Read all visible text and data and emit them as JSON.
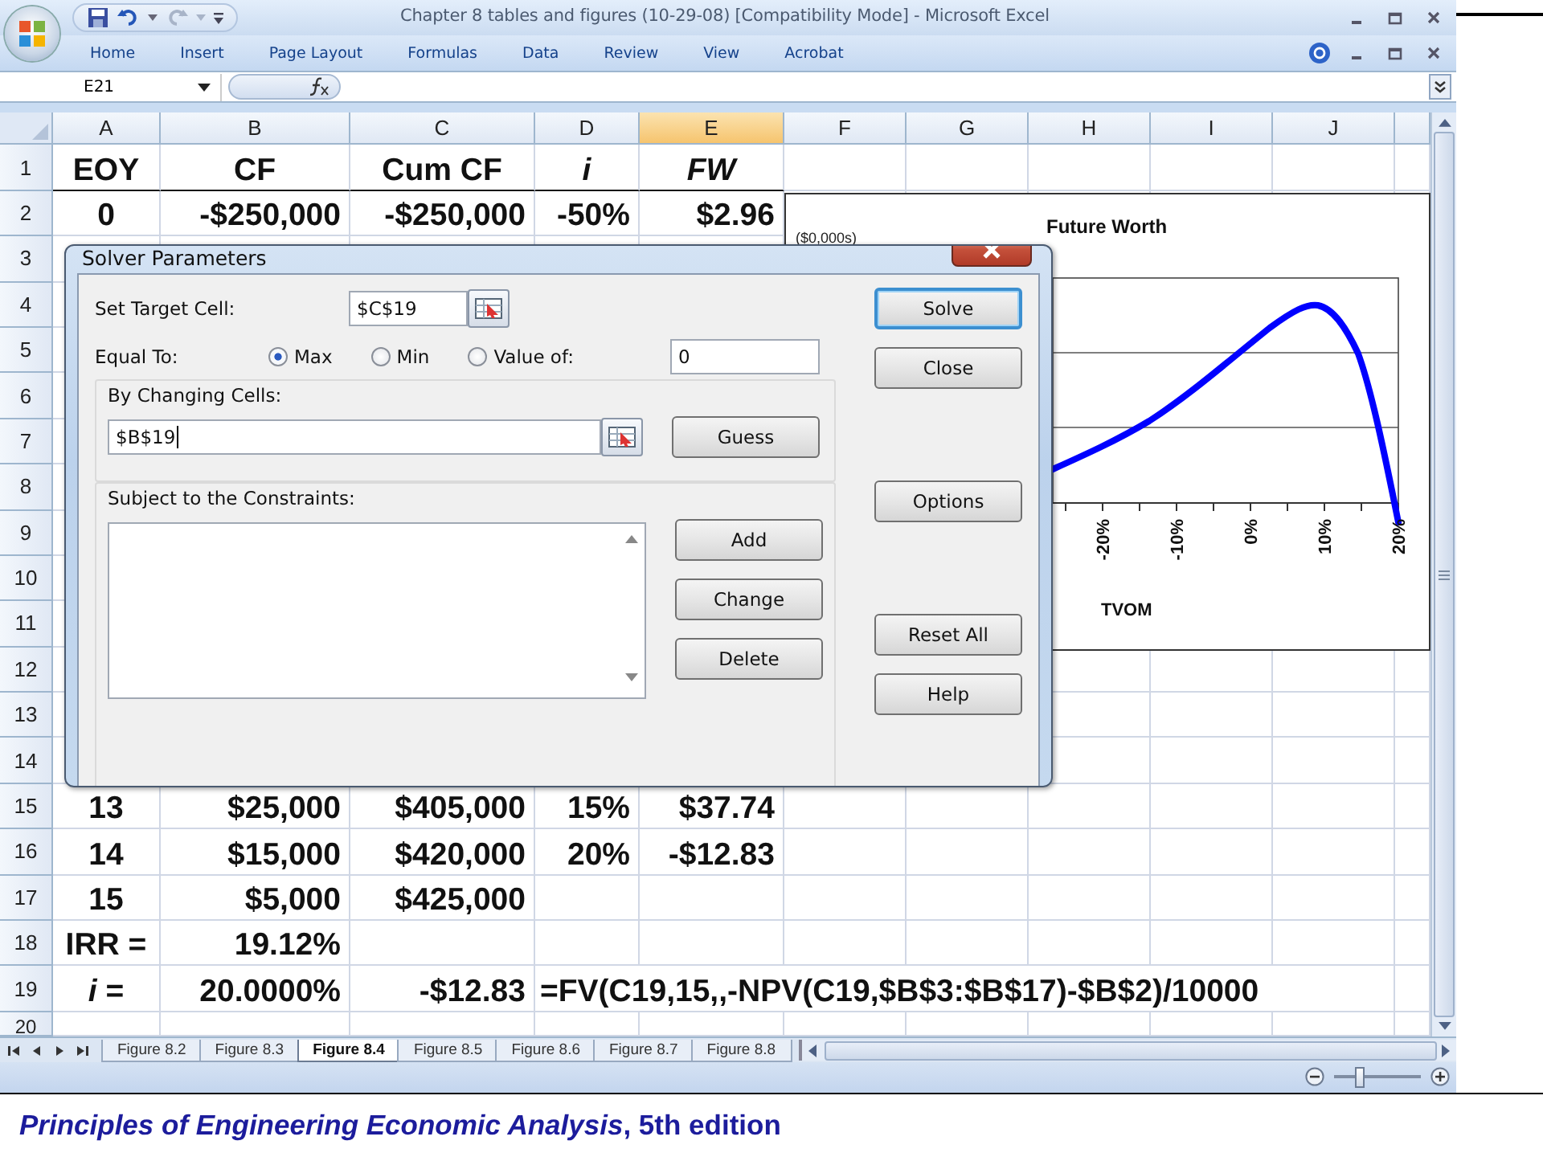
{
  "window": {
    "title": "Chapter 8 tables and figures (10-29-08)  [Compatibility Mode] - Microsoft Excel"
  },
  "ribbon_tabs": [
    {
      "label": "Home",
      "selected": false
    },
    {
      "label": "Insert",
      "selected": false
    },
    {
      "label": "Page Layout",
      "selected": false
    },
    {
      "label": "Formulas",
      "selected": false
    },
    {
      "label": "Data",
      "selected": false
    },
    {
      "label": "Review",
      "selected": false
    },
    {
      "label": "View",
      "selected": false
    },
    {
      "label": "Acrobat",
      "selected": false
    }
  ],
  "formula_bar": {
    "name_box": "E21"
  },
  "columns": [
    {
      "label": "A",
      "selected": false
    },
    {
      "label": "B",
      "selected": false
    },
    {
      "label": "C",
      "selected": false
    },
    {
      "label": "D",
      "selected": false
    },
    {
      "label": "E",
      "selected": true
    },
    {
      "label": "F",
      "selected": false
    },
    {
      "label": "G",
      "selected": false
    },
    {
      "label": "H",
      "selected": false
    },
    {
      "label": "I",
      "selected": false
    },
    {
      "label": "J",
      "selected": false
    }
  ],
  "header_row": {
    "num": "1",
    "cells": [
      {
        "text": "EOY",
        "italic": false
      },
      {
        "text": "CF",
        "italic": false
      },
      {
        "text": "Cum CF",
        "italic": false
      },
      {
        "text": "i",
        "italic": true
      },
      {
        "text": "FW",
        "italic": true
      }
    ]
  },
  "rows": [
    {
      "num": "2",
      "cells": [
        "0",
        "-$250,000",
        "-$250,000",
        "-50%",
        "$2.96"
      ]
    },
    {
      "num": "3"
    },
    {
      "num": "4"
    },
    {
      "num": "5"
    },
    {
      "num": "6"
    },
    {
      "num": "7"
    },
    {
      "num": "8"
    },
    {
      "num": "9"
    },
    {
      "num": "10"
    },
    {
      "num": "11"
    },
    {
      "num": "12"
    },
    {
      "num": "13"
    },
    {
      "num": "14"
    },
    {
      "num": "15",
      "cells": [
        "13",
        "$25,000",
        "$405,000",
        "15%",
        "$37.74"
      ]
    },
    {
      "num": "16",
      "cells": [
        "14",
        "$15,000",
        "$420,000",
        "20%",
        "-$12.83"
      ]
    },
    {
      "num": "17",
      "cells": [
        "15",
        "$5,000",
        "$425,000"
      ]
    },
    {
      "num": "18",
      "cells": [
        "IRR =",
        "19.12%"
      ]
    },
    {
      "num": "19",
      "cells": [
        "*i* =",
        "20.0000%",
        "-$12.83"
      ],
      "formula": "=FV(C19,15,,-NPV(C19,$B$3:$B$17)-$B$2)/10000"
    },
    {
      "num": "20"
    }
  ],
  "chart": {
    "title": "Future Worth",
    "unit_label": "($0,000s)",
    "x_tick_labels": [
      "-20%",
      "-10%",
      "0%",
      "10%",
      "20%"
    ],
    "xlabel": "TVOM"
  },
  "dialog": {
    "title": "Solver Parameters",
    "target": {
      "label": "Set Target Cell:",
      "value": "$C$19"
    },
    "equal_to": {
      "label": "Equal To:",
      "value": "0",
      "options": [
        {
          "label": "Max",
          "selected": true
        },
        {
          "label": "Min",
          "selected": false
        },
        {
          "label": "Value of:",
          "selected": false
        }
      ]
    },
    "changing": {
      "label": "By Changing Cells:",
      "value": "$B$19",
      "focused": true
    },
    "constraints": {
      "label": "Subject to the Constraints:"
    },
    "guess_button": {
      "label": "Guess"
    },
    "constraint_buttons": [
      {
        "label": "Add"
      },
      {
        "label": "Change"
      },
      {
        "label": "Delete"
      }
    ],
    "side_buttons": [
      {
        "label": "Solve",
        "default": true
      },
      {
        "label": "Close",
        "default": false
      },
      {
        "label": "Options",
        "default": false
      },
      {
        "label": "Reset All",
        "default": false
      },
      {
        "label": "Help",
        "default": false
      }
    ]
  },
  "sheet_tabs": [
    {
      "label": "Figure 8.2",
      "selected": false
    },
    {
      "label": "Figure 8.3",
      "selected": false
    },
    {
      "label": "Figure 8.4",
      "selected": true
    },
    {
      "label": "Figure 8.5",
      "selected": false
    },
    {
      "label": "Figure 8.6",
      "selected": false
    },
    {
      "label": "Figure 8.7",
      "selected": false
    },
    {
      "label": "Figure 8.8",
      "selected": false
    }
  ],
  "status_bar": {
    "zoom_slider": {
      "level": 0.3
    }
  },
  "caption": "*Principles of Engineering Economic Analysis*, 5th edition"
}
